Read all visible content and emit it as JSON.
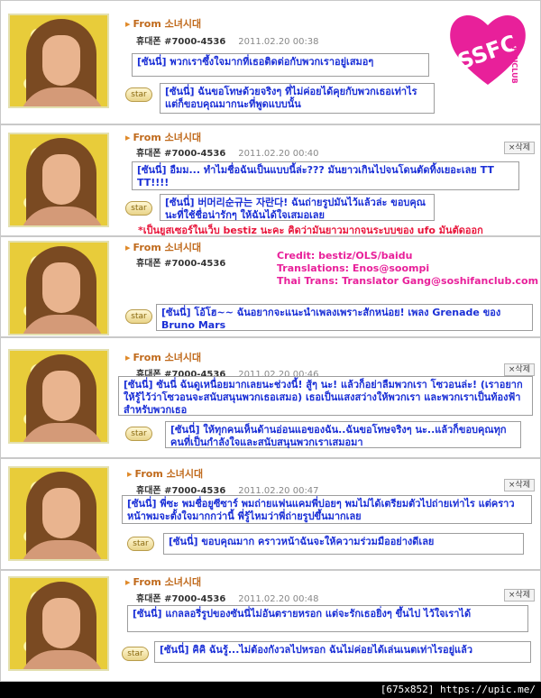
{
  "header": {
    "from_label": "From 소녀시대"
  },
  "posts": [
    {
      "from": "From 소녀시대",
      "phone": "휴대폰 #7000-4536",
      "time": "2011.02.20 00:38",
      "message": "[ซันนี่] พวกเราซึ้งใจมากที่เธอติดต่อกับพวกเราอยู่เสมอๆ",
      "reply": "[ซันนี่] ฉันขอโทษด้วยจริงๆ ที่ไม่ค่อยได้คุยกับพวกเธอเท่าไร แต่ก็ขอบคุณมากนะที่พูดแบบนั้น"
    },
    {
      "from": "From 소녀시대",
      "phone": "휴대폰 #7000-4536",
      "time": "2011.02.20 00:40",
      "delete": "×삭제",
      "message": "[ซันนี่] อืมม... ทำไมชื่อฉันเป็นแบบนี้ล่ะ??? มันยาวเกินไปจนโดนตัดทิ้งเยอะเลย TT TT!!!!",
      "reply": "[ซันนี่] 버머리순규는 자란다! ฉันถ่ายรูปมันไว้แล้วล่ะ ขอบคุณนะที่ใช้ชื่อน่ารักๆ ให้ฉันได้ใจเสมอเลย",
      "note": "*เป็นยูสเซอร์ในเว็บ bestiz นะคะ คิดว่ามันยาวมากจนระบบของ ufo มันตัดออก"
    },
    {
      "from": "From 소녀시대",
      "phone": "휴대폰 #7000-4536",
      "reply": "[ซันนี่] โอ้โฮ~~ ฉันอยากจะแนะนำเพลงเพราะสักหน่อย! เพลง Grenade ของ Bruno Mars"
    },
    {
      "from": "From 소녀시대",
      "phone": "휴대폰 #7000-4536",
      "time": "2011.02.20 00:46",
      "delete": "×삭제",
      "message": "[ซันนี่] ซันนี่ ฉันดูเหนื่อยมากเลยนะช่วงนี้! สู้ๆ นะ! แล้วก็อย่าลืมพวกเรา โซวอนล่ะ! (เราอยากให้รู้ไว้ว่าโซวอนจะสนับสนุนพวกเธอเสมอ) เธอเป็นแสงสว่างให้พวกเรา และพวกเราเป็นท้องฟ้าสำหรับพวกเธอ",
      "reply": "[ซันนี่] ให้ทุกคนเห็นด้านอ่อนแอของฉัน..ฉันขอโทษจริงๆ นะ..แล้วก็ขอบคุณทุกคนที่เป็นกำลังใจและสนับสนุนพวกเราเสมอมา"
    },
    {
      "from": "From 소녀시대",
      "phone": "휴대폰 #7000-4536",
      "time": "2011.02.20 00:47",
      "delete": "×삭제",
      "message": "[ซันนี่] พี่ซะ พมชื่อยูซีซาร์ พมถ่ายแฟนแคมพี่บ่อยๆ พมไม่ได้เตรียมตัวไปถ่ายเท่าไร แต่คราวหน้าพมจะตั้งใจมากกว่านี้ พี่รู้ไหมว่าพี่ถ่ายรูปขึ้นมากเลย",
      "reply": "[ซันนี่] ขอบคุณมาก คราวหน้าฉันจะให้ความร่วมมืออย่างดีเลย"
    },
    {
      "from": "From 소녀시대",
      "phone": "휴대폰 #7000-4536",
      "time": "2011.02.20 00:48",
      "delete": "×삭제",
      "message": "[ซันนี่] แกลลอรี่รูปของซันนี่ไม่อันตรายหรอก แต่จะรักเธอยิ่งๆ ขึ้นไป ไว้ใจเราได้",
      "reply": "[ซันนี่] คิคิ ฉันรู้...ไม่ต้องกังวลไปหรอก ฉันไม่ค่อยได้เล่นเนตเท่าไรอยู่แล้ว"
    }
  ],
  "star_label": "star",
  "credits": {
    "line1": "Credit: bestiz/OLS/baidu",
    "line2": "Translations: Enos@soompi",
    "line3": "Thai Trans: Translator Gang@soshifanclub.com"
  },
  "logo": {
    "letters": "SSFC",
    "side_text": "SOSHIFANCLUB"
  },
  "footer": {
    "text": "[675x852] https://upic.me/"
  },
  "colors": {
    "message_text": "#1a2fd6",
    "from_label": "#c06a1c",
    "credits": "#e8209a",
    "note": "#e8163b"
  }
}
